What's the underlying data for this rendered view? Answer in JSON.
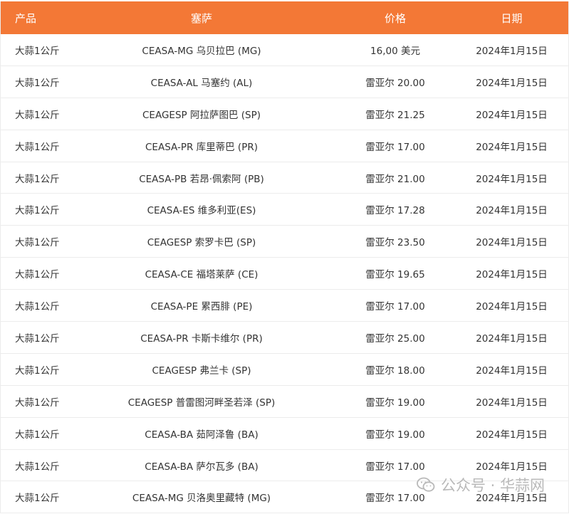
{
  "table": {
    "headers": {
      "product": "产品",
      "ceasa": "塞萨",
      "price": "价格",
      "date": "日期"
    },
    "rows": [
      {
        "product": "大蒜1公斤",
        "ceasa": "CEASA-MG 乌贝拉巴 (MG)",
        "price": "16,00 美元",
        "date": "2024年1月15日"
      },
      {
        "product": "大蒜1公斤",
        "ceasa": "CEASA-AL 马塞约 (AL)",
        "price": "雷亚尔 20.00",
        "date": "2024年1月15日"
      },
      {
        "product": "大蒜1公斤",
        "ceasa": "CEAGESP 阿拉萨图巴 (SP)",
        "price": "雷亚尔 21.25",
        "date": "2024年1月15日"
      },
      {
        "product": "大蒜1公斤",
        "ceasa": "CEASA-PR 库里蒂巴 (PR)",
        "price": "雷亚尔 17.00",
        "date": "2024年1月15日"
      },
      {
        "product": "大蒜1公斤",
        "ceasa": "CEASA-PB 若昂·佩索阿 (PB)",
        "price": "雷亚尔 21.00",
        "date": "2024年1月15日"
      },
      {
        "product": "大蒜1公斤",
        "ceasa": "CEASA-ES 维多利亚(ES)",
        "price": "雷亚尔 17.28",
        "date": "2024年1月15日"
      },
      {
        "product": "大蒜1公斤",
        "ceasa": "CEAGESP 索罗卡巴 (SP)",
        "price": "雷亚尔 23.50",
        "date": "2024年1月15日"
      },
      {
        "product": "大蒜1公斤",
        "ceasa": "CEASA-CE 福塔莱萨 (CE)",
        "price": "雷亚尔 19.65",
        "date": "2024年1月15日"
      },
      {
        "product": "大蒜1公斤",
        "ceasa": "CEASA-PE 累西腓 (PE)",
        "price": "雷亚尔 17.00",
        "date": "2024年1月15日"
      },
      {
        "product": "大蒜1公斤",
        "ceasa": "CEASA-PR 卡斯卡维尔 (PR)",
        "price": "雷亚尔 25.00",
        "date": "2024年1月15日"
      },
      {
        "product": "大蒜1公斤",
        "ceasa": "CEAGESP 弗兰卡 (SP)",
        "price": "雷亚尔 18.00",
        "date": "2024年1月15日"
      },
      {
        "product": "大蒜1公斤",
        "ceasa": "CEAGESP 普雷图河畔圣若泽 (SP)",
        "price": "雷亚尔 19.00",
        "date": "2024年1月15日"
      },
      {
        "product": "大蒜1公斤",
        "ceasa": "CEASA-BA 茹阿泽鲁 (BA)",
        "price": "雷亚尔 19.00",
        "date": "2024年1月15日"
      },
      {
        "product": "大蒜1公斤",
        "ceasa": "CEASA-BA 萨尔瓦多 (BA)",
        "price": "雷亚尔 17.00",
        "date": "2024年1月15日"
      },
      {
        "product": "大蒜1公斤",
        "ceasa": "CEASA-MG 贝洛奥里藏特 (MG)",
        "price": "雷亚尔 17.00",
        "date": "2024年1月15日"
      }
    ]
  },
  "watermark": {
    "text": "公众号 · 华蒜网",
    "icon": "wechat-icon"
  },
  "colors": {
    "header_bg": "#f37836",
    "header_text": "#ffffff",
    "row_border": "#ececec"
  }
}
